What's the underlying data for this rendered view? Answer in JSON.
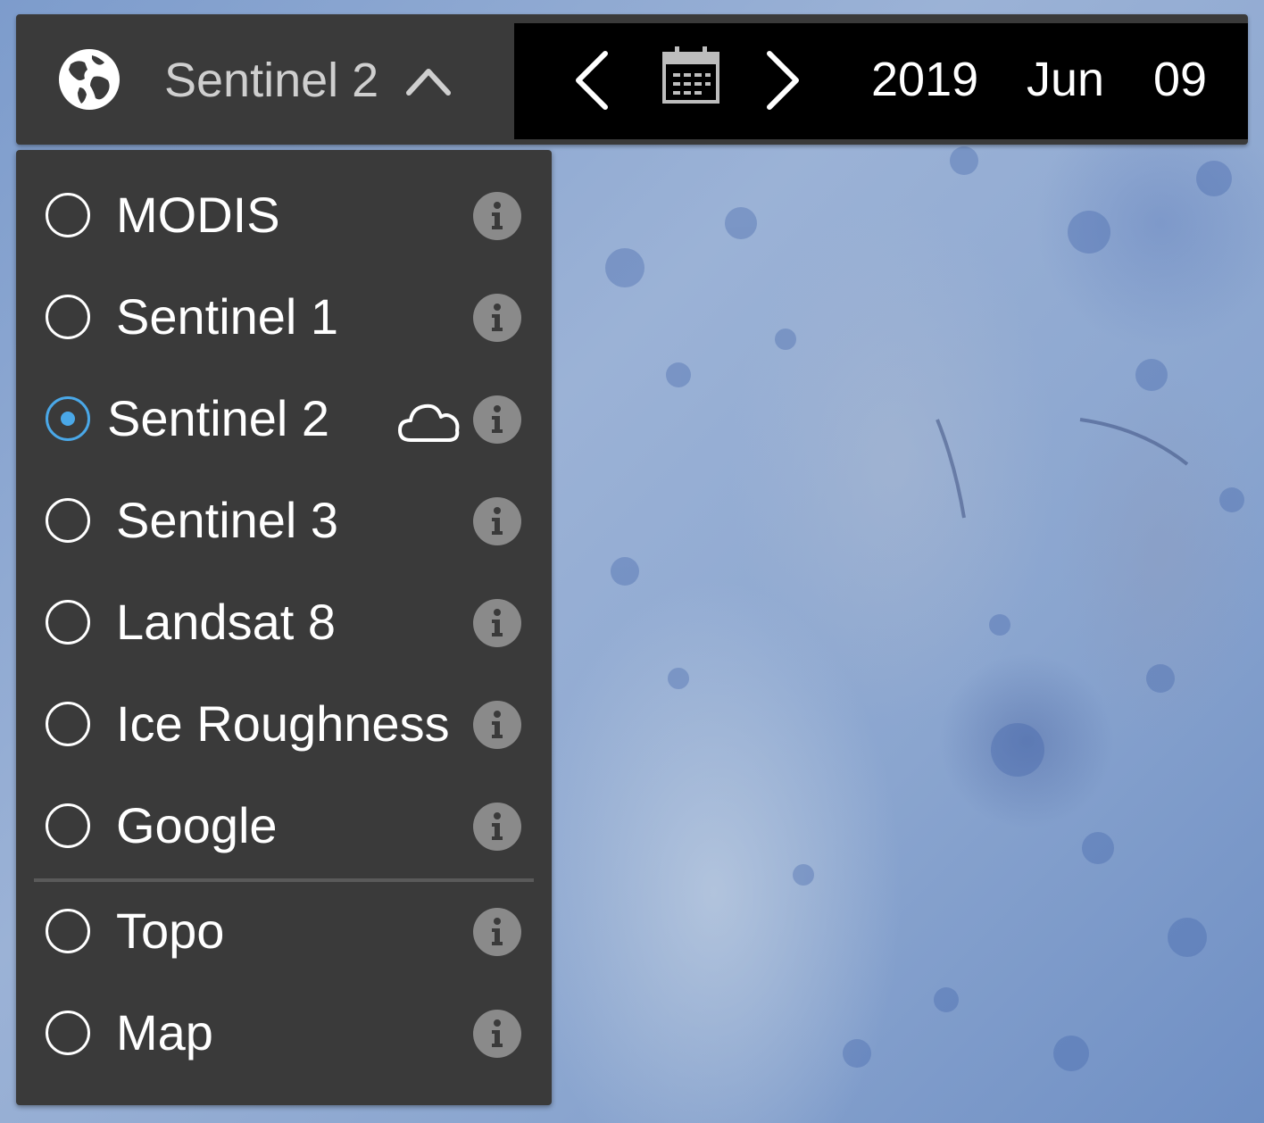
{
  "layer_selector": {
    "current_label": "Sentinel 2"
  },
  "date": {
    "year": "2019",
    "month": "Jun",
    "day": "09"
  },
  "layers": [
    {
      "label": "MODIS",
      "selected": false
    },
    {
      "label": "Sentinel 1",
      "selected": false
    },
    {
      "label": "Sentinel 2",
      "selected": true
    },
    {
      "label": "Sentinel 3",
      "selected": false
    },
    {
      "label": "Landsat 8",
      "selected": false
    },
    {
      "label": "Ice Roughness",
      "selected": false
    },
    {
      "label": "Google",
      "selected": false
    }
  ],
  "base_layers": [
    {
      "label": "Topo",
      "selected": false
    },
    {
      "label": "Map",
      "selected": false
    }
  ],
  "icons": {
    "globe": "globe-icon",
    "chevron": "chevron-up-icon",
    "prev": "chevron-left-icon",
    "next": "chevron-right-icon",
    "calendar": "calendar-icon",
    "info": "info-icon",
    "cloud": "cloud-icon"
  },
  "colors": {
    "panel_bg": "#3a3a3a",
    "date_bg": "#000000",
    "accent": "#4aa8e8",
    "info_bg": "#8a8a8a"
  }
}
